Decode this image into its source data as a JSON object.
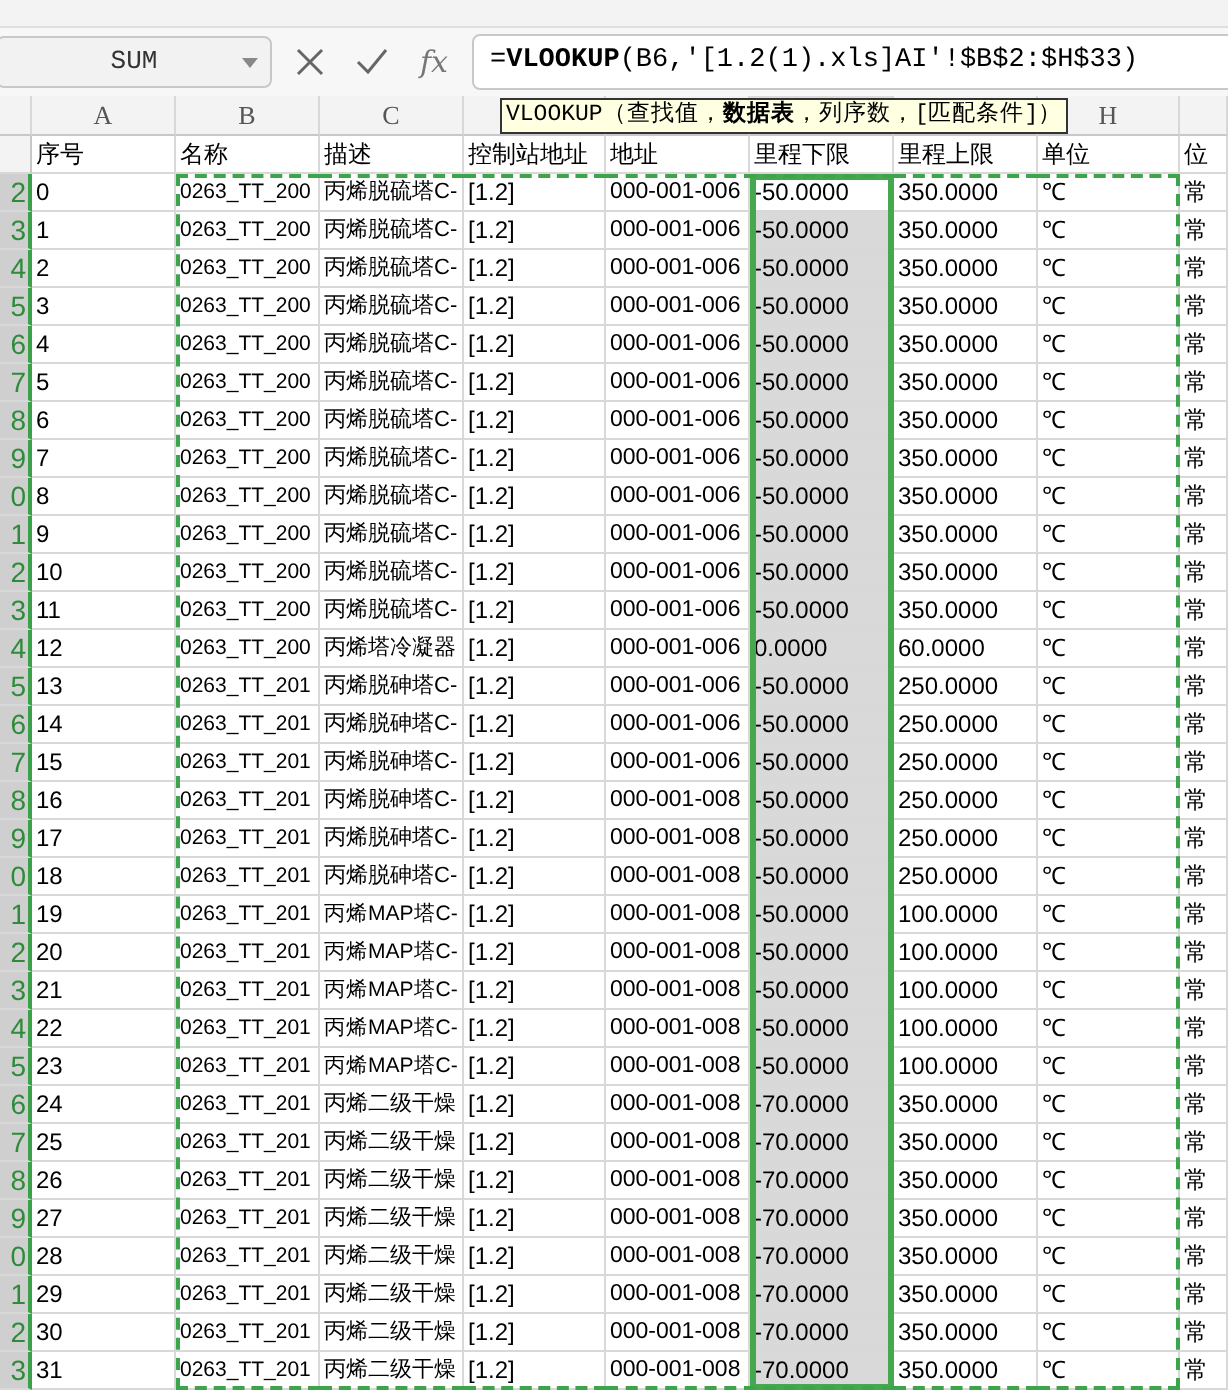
{
  "formula_bar": {
    "name_box": "SUM",
    "fx": "fx",
    "formula": "=**VLOOKUP**(B6,'[1.2(1).xls]AI'!$B$2:$H$33)"
  },
  "tooltip": "VLOOKUP（查找值，**数据表**，列序数，[匹配条件]）",
  "column_headers": [
    {
      "label": "A",
      "selected": false,
      "copied": false
    },
    {
      "label": "B",
      "selected": false,
      "copied": true
    },
    {
      "label": "C",
      "selected": false,
      "copied": true
    },
    {
      "selected": false,
      "copied": true
    },
    {
      "selected": false,
      "copied": true
    },
    {
      "selected": true,
      "copied": true
    },
    {
      "selected": false,
      "copied": true
    },
    {
      "label": "H",
      "selected": false,
      "copied": true
    },
    {
      "selected": false,
      "copied": false
    }
  ],
  "header_row": [
    "序号",
    "名称",
    "描述",
    "控制站地址",
    "地址",
    "里程下限",
    "里程上限",
    "单位",
    "位"
  ],
  "rows": [
    {
      "number": "2",
      "selected": true,
      "active": true,
      "cells": [
        "0",
        "0263_TT_200",
        "丙烯脱硫塔C-",
        "[1.2]",
        "000-001-006",
        "-50.0000",
        "350.0000",
        "℃",
        "常"
      ]
    },
    {
      "number": "3",
      "selected": true,
      "active": false,
      "cells": [
        "1",
        "0263_TT_200",
        "丙烯脱硫塔C-",
        "[1.2]",
        "000-001-006",
        "-50.0000",
        "350.0000",
        "℃",
        "常"
      ]
    },
    {
      "number": "4",
      "selected": true,
      "active": false,
      "cells": [
        "2",
        "0263_TT_200",
        "丙烯脱硫塔C-",
        "[1.2]",
        "000-001-006",
        "-50.0000",
        "350.0000",
        "℃",
        "常"
      ]
    },
    {
      "number": "5",
      "selected": true,
      "active": false,
      "cells": [
        "3",
        "0263_TT_200",
        "丙烯脱硫塔C-",
        "[1.2]",
        "000-001-006",
        "-50.0000",
        "350.0000",
        "℃",
        "常"
      ]
    },
    {
      "number": "6",
      "selected": true,
      "active": false,
      "cells": [
        "4",
        "0263_TT_200",
        "丙烯脱硫塔C-",
        "[1.2]",
        "000-001-006",
        "-50.0000",
        "350.0000",
        "℃",
        "常"
      ]
    },
    {
      "number": "7",
      "selected": true,
      "active": false,
      "cells": [
        "5",
        "0263_TT_200",
        "丙烯脱硫塔C-",
        "[1.2]",
        "000-001-006",
        "-50.0000",
        "350.0000",
        "℃",
        "常"
      ]
    },
    {
      "number": "8",
      "selected": true,
      "active": false,
      "cells": [
        "6",
        "0263_TT_200",
        "丙烯脱硫塔C-",
        "[1.2]",
        "000-001-006",
        "-50.0000",
        "350.0000",
        "℃",
        "常"
      ]
    },
    {
      "number": "9",
      "selected": true,
      "active": false,
      "cells": [
        "7",
        "0263_TT_200",
        "丙烯脱硫塔C-",
        "[1.2]",
        "000-001-006",
        "-50.0000",
        "350.0000",
        "℃",
        "常"
      ]
    },
    {
      "number": "0",
      "selected": true,
      "active": false,
      "cells": [
        "8",
        "0263_TT_200",
        "丙烯脱硫塔C-",
        "[1.2]",
        "000-001-006",
        "-50.0000",
        "350.0000",
        "℃",
        "常"
      ]
    },
    {
      "number": "1",
      "selected": true,
      "active": false,
      "cells": [
        "9",
        "0263_TT_200",
        "丙烯脱硫塔C-",
        "[1.2]",
        "000-001-006",
        "-50.0000",
        "350.0000",
        "℃",
        "常"
      ]
    },
    {
      "number": "2",
      "selected": true,
      "active": false,
      "cells": [
        "10",
        "0263_TT_200",
        "丙烯脱硫塔C-",
        "[1.2]",
        "000-001-006",
        "-50.0000",
        "350.0000",
        "℃",
        "常"
      ]
    },
    {
      "number": "3",
      "selected": true,
      "active": false,
      "cells": [
        "11",
        "0263_TT_200",
        "丙烯脱硫塔C-",
        "[1.2]",
        "000-001-006",
        "-50.0000",
        "350.0000",
        "℃",
        "常"
      ]
    },
    {
      "number": "4",
      "selected": true,
      "active": false,
      "cells": [
        "12",
        "0263_TT_200",
        "丙烯塔冷凝器",
        "[1.2]",
        "000-001-006",
        "0.0000",
        "60.0000",
        "℃",
        "常"
      ]
    },
    {
      "number": "5",
      "selected": true,
      "active": false,
      "cells": [
        "13",
        "0263_TT_201",
        "丙烯脱砷塔C-",
        "[1.2]",
        "000-001-006",
        "-50.0000",
        "250.0000",
        "℃",
        "常"
      ]
    },
    {
      "number": "6",
      "selected": true,
      "active": false,
      "cells": [
        "14",
        "0263_TT_201",
        "丙烯脱砷塔C-",
        "[1.2]",
        "000-001-006",
        "-50.0000",
        "250.0000",
        "℃",
        "常"
      ]
    },
    {
      "number": "7",
      "selected": true,
      "active": false,
      "cells": [
        "15",
        "0263_TT_201",
        "丙烯脱砷塔C-",
        "[1.2]",
        "000-001-006",
        "-50.0000",
        "250.0000",
        "℃",
        "常"
      ]
    },
    {
      "number": "8",
      "selected": true,
      "active": false,
      "cells": [
        "16",
        "0263_TT_201",
        "丙烯脱砷塔C-",
        "[1.2]",
        "000-001-008",
        "-50.0000",
        "250.0000",
        "℃",
        "常"
      ]
    },
    {
      "number": "9",
      "selected": true,
      "active": false,
      "cells": [
        "17",
        "0263_TT_201",
        "丙烯脱砷塔C-",
        "[1.2]",
        "000-001-008",
        "-50.0000",
        "250.0000",
        "℃",
        "常"
      ]
    },
    {
      "number": "0",
      "selected": true,
      "active": false,
      "cells": [
        "18",
        "0263_TT_201",
        "丙烯脱砷塔C-",
        "[1.2]",
        "000-001-008",
        "-50.0000",
        "250.0000",
        "℃",
        "常"
      ]
    },
    {
      "number": "1",
      "selected": true,
      "active": false,
      "cells": [
        "19",
        "0263_TT_201",
        "丙烯MAP塔C-",
        "[1.2]",
        "000-001-008",
        "-50.0000",
        "100.0000",
        "℃",
        "常"
      ]
    },
    {
      "number": "2",
      "selected": true,
      "active": false,
      "cells": [
        "20",
        "0263_TT_201",
        "丙烯MAP塔C-",
        "[1.2]",
        "000-001-008",
        "-50.0000",
        "100.0000",
        "℃",
        "常"
      ]
    },
    {
      "number": "3",
      "selected": true,
      "active": false,
      "cells": [
        "21",
        "0263_TT_201",
        "丙烯MAP塔C-",
        "[1.2]",
        "000-001-008",
        "-50.0000",
        "100.0000",
        "℃",
        "常"
      ]
    },
    {
      "number": "4",
      "selected": true,
      "active": false,
      "cells": [
        "22",
        "0263_TT_201",
        "丙烯MAP塔C-",
        "[1.2]",
        "000-001-008",
        "-50.0000",
        "100.0000",
        "℃",
        "常"
      ]
    },
    {
      "number": "5",
      "selected": true,
      "active": false,
      "cells": [
        "23",
        "0263_TT_201",
        "丙烯MAP塔C-",
        "[1.2]",
        "000-001-008",
        "-50.0000",
        "100.0000",
        "℃",
        "常"
      ]
    },
    {
      "number": "6",
      "selected": true,
      "active": false,
      "cells": [
        "24",
        "0263_TT_201",
        "丙烯二级干燥",
        "[1.2]",
        "000-001-008",
        "-70.0000",
        "350.0000",
        "℃",
        "常"
      ]
    },
    {
      "number": "7",
      "selected": true,
      "active": false,
      "cells": [
        "25",
        "0263_TT_201",
        "丙烯二级干燥",
        "[1.2]",
        "000-001-008",
        "-70.0000",
        "350.0000",
        "℃",
        "常"
      ]
    },
    {
      "number": "8",
      "selected": true,
      "active": false,
      "cells": [
        "26",
        "0263_TT_201",
        "丙烯二级干燥",
        "[1.2]",
        "000-001-008",
        "-70.0000",
        "350.0000",
        "℃",
        "常"
      ]
    },
    {
      "number": "9",
      "selected": true,
      "active": false,
      "cells": [
        "27",
        "0263_TT_201",
        "丙烯二级干燥",
        "[1.2]",
        "000-001-008",
        "-70.0000",
        "350.0000",
        "℃",
        "常"
      ]
    },
    {
      "number": "0",
      "selected": true,
      "active": false,
      "cells": [
        "28",
        "0263_TT_201",
        "丙烯二级干燥",
        "[1.2]",
        "000-001-008",
        "-70.0000",
        "350.0000",
        "℃",
        "常"
      ]
    },
    {
      "number": "1",
      "selected": true,
      "active": false,
      "cells": [
        "29",
        "0263_TT_201",
        "丙烯二级干燥",
        "[1.2]",
        "000-001-008",
        "-70.0000",
        "350.0000",
        "℃",
        "常"
      ]
    },
    {
      "number": "2",
      "selected": true,
      "active": false,
      "cells": [
        "30",
        "0263_TT_201",
        "丙烯二级干燥",
        "[1.2]",
        "000-001-008",
        "-70.0000",
        "350.0000",
        "℃",
        "常"
      ]
    },
    {
      "number": "3",
      "selected": true,
      "active": false,
      "cells": [
        "31",
        "0263_TT_201",
        "丙烯二级干燥",
        "[1.2]",
        "000-001-008",
        "-70.0000",
        "350.0000",
        "℃",
        "常"
      ]
    }
  ]
}
